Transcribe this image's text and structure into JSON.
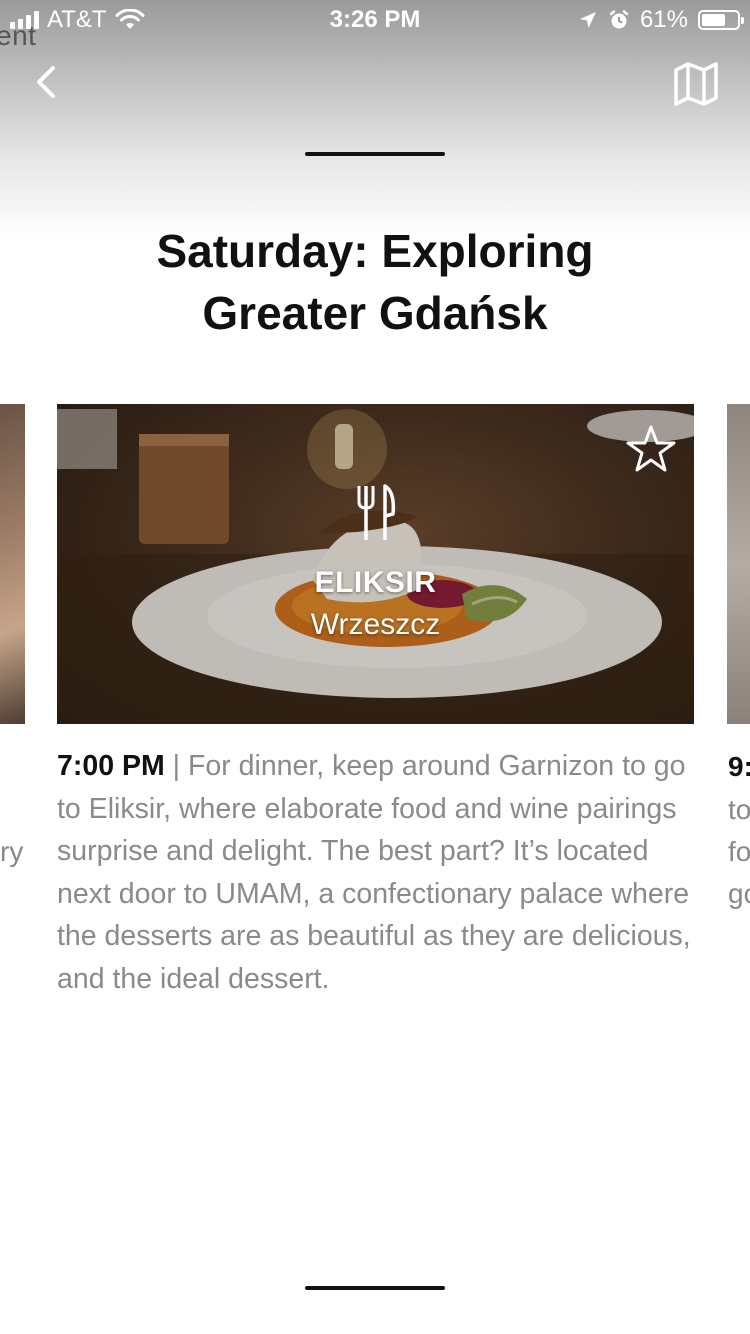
{
  "status_bar": {
    "carrier": "AT&T",
    "time": "3:26 PM",
    "battery": "61%",
    "battery_level": 0.61
  },
  "background_text": "ent",
  "header": {
    "back_icon": "chevron-left-icon",
    "map_icon": "map-icon",
    "title": "Saturday: Exploring Greater Gdańsk"
  },
  "card": {
    "category_icon": "fork-knife-icon",
    "favorite_icon": "star-outline-icon",
    "name": "ELIKSIR",
    "location": "Wrzeszcz",
    "time": "7:00 PM",
    "separator": "|",
    "description": "For dinner, keep around Garnizon to go to Eliksir, where elaborate food and wine pairings surprise and delight. The best part? It’s located next door to UMAM, a confectionary palace where the desserts are as beautiful as they are delicious, and the ideal dessert."
  },
  "adjacent_cards": {
    "left_fragment": "ry",
    "right_time_fragment": "9:",
    "right_lines": [
      "to",
      "fo",
      "go"
    ]
  },
  "colors": {
    "text_primary": "#111111",
    "text_secondary": "#8a8a8a",
    "icon_white": "#ffffff"
  }
}
